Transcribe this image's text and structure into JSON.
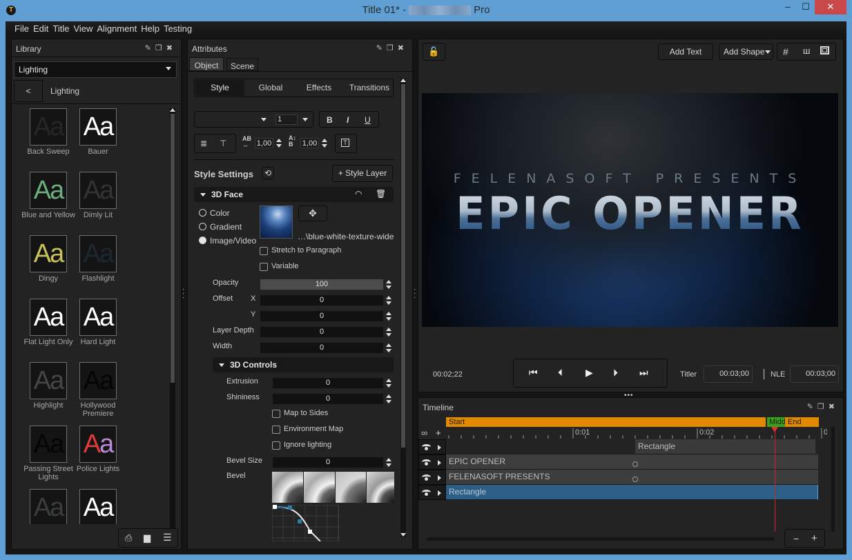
{
  "window": {
    "title_prefix": "Title 01* -",
    "title_suffix": "Pro",
    "logo_glyph": "T",
    "minimize": "‒",
    "maximize": "☐",
    "close": "✕"
  },
  "menu": [
    "File",
    "Edit",
    "Title",
    "View",
    "Alignment",
    "Help",
    "Testing"
  ],
  "library": {
    "title": "Library",
    "category": "Lighting",
    "back_label": "<",
    "breadcrumb": "Lighting",
    "items": [
      {
        "name": "Back Sweep",
        "color": "#262626"
      },
      {
        "name": "Bauer",
        "color": "#ffffff"
      },
      {
        "name": "Blue and Yellow",
        "color": "#6bae7c"
      },
      {
        "name": "Dimly Lit",
        "color": "#333333"
      },
      {
        "name": "Dingy",
        "color": "#c9c25a"
      },
      {
        "name": "Flashlight",
        "color": "#1c2733"
      },
      {
        "name": "Flat Light Only",
        "color": "#ffffff"
      },
      {
        "name": "Hard Light",
        "color": "#ffffff"
      },
      {
        "name": "Highlight",
        "color": "#454545"
      },
      {
        "name": "Hollywood Premiere",
        "color": "#050505"
      },
      {
        "name": "Passing Street Lights",
        "color": "#050505"
      },
      {
        "name": "Police Lights",
        "color": "#d84040"
      },
      {
        "name": "",
        "color": "#3a3d3d"
      },
      {
        "name": "",
        "color": "#ffffff"
      }
    ],
    "thumb_glyph": "Aa",
    "footer_icons": [
      "save-preset-icon",
      "new-folder-icon",
      "list-view-icon"
    ]
  },
  "attributes": {
    "title": "Attributes",
    "tabs": [
      "Object",
      "Scene"
    ],
    "active_tab": "Object",
    "subtabs": [
      "Style",
      "Global",
      "Effects",
      "Transitions"
    ],
    "active_subtab": "Style",
    "font_name": "",
    "font_size": "1",
    "bold": "B",
    "italic": "I",
    "underline": "U",
    "tracking": "1,00",
    "leading": "1,00",
    "style_settings": "Style Settings",
    "style_layer_btn": "+ Style Layer",
    "face_section": "3D Face",
    "fill_options": [
      "Color",
      "Gradient",
      "Image/Video"
    ],
    "fill_selected": "Image/Video",
    "image_path": "…\\blue-white-texture-wide",
    "stretch_label": "Stretch to Paragraph",
    "variable_label": "Variable",
    "opacity_label": "Opacity",
    "opacity": "100",
    "offset_label": "Offset",
    "x_label": "X",
    "offset_x": "0",
    "y_label": "Y",
    "offset_y": "0",
    "layer_depth_label": "Layer Depth",
    "layer_depth": "0",
    "width_label": "Width",
    "width": "0",
    "controls_section": "3D Controls",
    "extrusion_label": "Extrusion",
    "extrusion": "0",
    "shininess_label": "Shininess",
    "shininess": "0",
    "map_sides_label": "Map to Sides",
    "env_map_label": "Environment Map",
    "ignore_lighting_label": "Ignore lighting",
    "bevel_size_label": "Bevel Size",
    "bevel_size": "0",
    "bevel_label": "Bevel"
  },
  "preview": {
    "add_text": "Add Text",
    "add_shape": "Add Shape",
    "subtitle": "FELENASOFT PRESENTS",
    "headline": "EPIC OPENER",
    "current_time": "00:02;22",
    "titler_label": "Titler",
    "titler_time": "00:03;00",
    "nle_label": "NLE",
    "nle_time": "00:03;00"
  },
  "timeline": {
    "title": "Timeline",
    "markers": {
      "start": "Start",
      "middle": "Midd",
      "end": "End"
    },
    "ticks": [
      "0:01",
      "0:02",
      "0"
    ],
    "playhead_seconds": 2.62,
    "tracks": [
      {
        "name": "Rectangle",
        "clip_label": "Rectangle",
        "selected": false
      },
      {
        "name": "EPIC OPENER",
        "clip_label": "EPIC OPENER",
        "selected": false
      },
      {
        "name": "FELENASOFT PRESENTS",
        "clip_label": "FELENASOFT PRESENTS",
        "selected": false
      },
      {
        "name": "Rectangle",
        "clip_label": "Rectangle",
        "selected": true
      }
    ],
    "zoom_out": "−",
    "zoom_in": "+"
  }
}
